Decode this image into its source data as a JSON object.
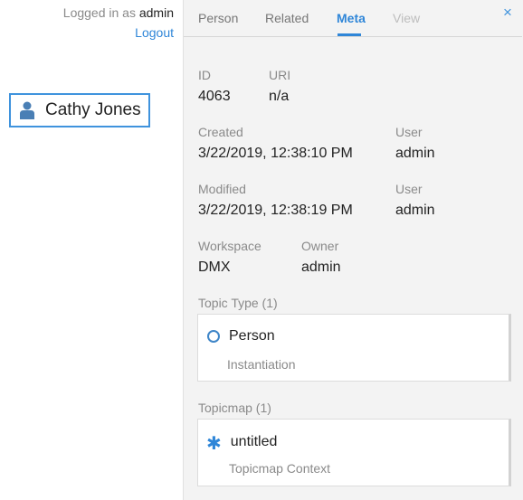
{
  "login": {
    "prefix": "Logged in as",
    "username": "admin",
    "logout_label": "Logout"
  },
  "canvas": {
    "topic_label": "Cathy Jones",
    "topic_icon": "person-icon"
  },
  "panel": {
    "tabs": [
      {
        "label": "Person",
        "state": "normal"
      },
      {
        "label": "Related",
        "state": "normal"
      },
      {
        "label": "Meta",
        "state": "active"
      },
      {
        "label": "View",
        "state": "disabled"
      }
    ],
    "close_icon": "×",
    "meta": {
      "id_label": "ID",
      "id_value": "4063",
      "uri_label": "URI",
      "uri_value": "n/a",
      "created_label": "Created",
      "created_value": "3/22/2019, 12:38:10 PM",
      "created_user_label": "User",
      "created_user_value": "admin",
      "modified_label": "Modified",
      "modified_value": "3/22/2019, 12:38:19 PM",
      "modified_user_label": "User",
      "modified_user_value": "admin",
      "workspace_label": "Workspace",
      "workspace_value": "DMX",
      "owner_label": "Owner",
      "owner_value": "admin"
    },
    "topic_type_section": {
      "title": "Topic Type (1)",
      "item_label": "Person",
      "item_icon": "circle-icon",
      "assoc_label": "Instantiation"
    },
    "topicmap_section": {
      "title": "Topicmap (1)",
      "item_label": "untitled",
      "item_icon": "asterisk-icon",
      "assoc_label": "Topicmap Context"
    }
  },
  "colors": {
    "accent": "#2f86d8",
    "panel_bg": "#f3f3f3",
    "node_border": "#3f93dd"
  }
}
